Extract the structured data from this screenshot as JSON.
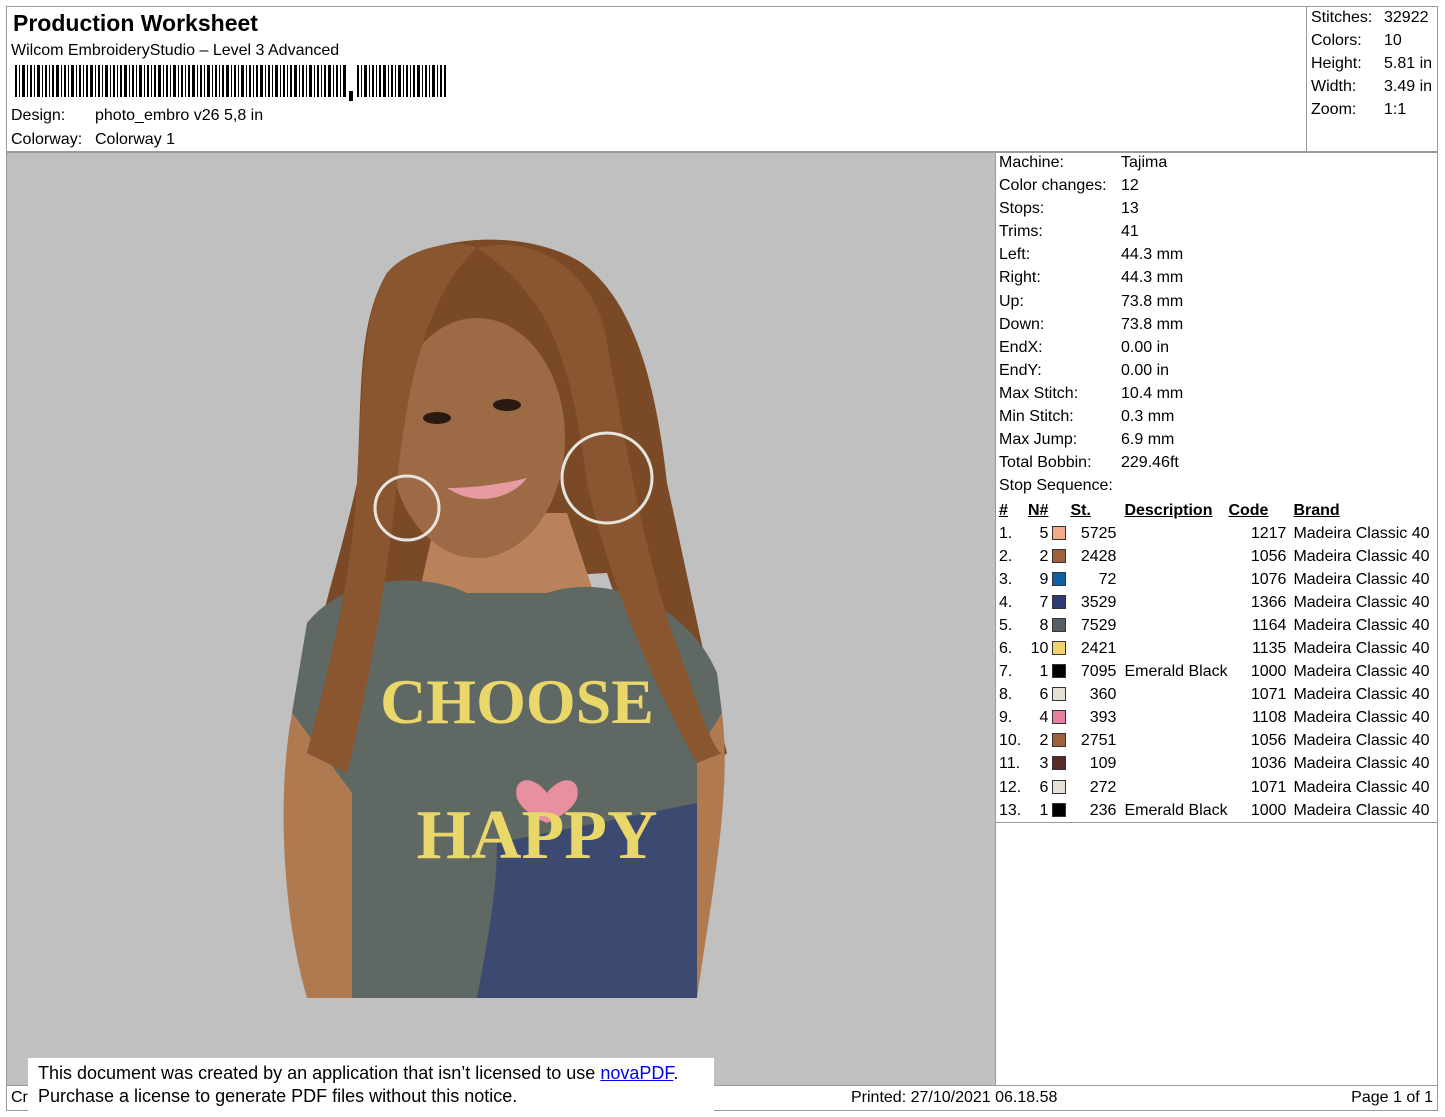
{
  "header": {
    "title": "Production Worksheet",
    "subtitle": "Wilcom EmbroideryStudio – Level 3 Advanced",
    "design_label": "Design:",
    "design_value": "photo_embro v26 5,8 in",
    "colorway_label": "Colorway:",
    "colorway_value": "Colorway 1"
  },
  "summary": [
    {
      "label": "Stitches:",
      "value": "32922"
    },
    {
      "label": "Colors:",
      "value": "10"
    },
    {
      "label": "Height:",
      "value": "5.81 in"
    },
    {
      "label": "Width:",
      "value": "3.49 in"
    },
    {
      "label": "Zoom:",
      "value": "1:1"
    }
  ],
  "machine_info": [
    {
      "label": "Machine:",
      "value": "Tajima"
    },
    {
      "label": "Color changes:",
      "value": "12"
    },
    {
      "label": "Stops:",
      "value": "13"
    },
    {
      "label": "Trims:",
      "value": "41"
    },
    {
      "label": "Left:",
      "value": "44.3 mm"
    },
    {
      "label": "Right:",
      "value": "44.3 mm"
    },
    {
      "label": "Up:",
      "value": "73.8 mm"
    },
    {
      "label": "Down:",
      "value": "73.8 mm"
    },
    {
      "label": "EndX:",
      "value": "0.00 in"
    },
    {
      "label": "EndY:",
      "value": "0.00 in"
    },
    {
      "label": "Max Stitch:",
      "value": "10.4 mm"
    },
    {
      "label": "Min Stitch:",
      "value": "0.3 mm"
    },
    {
      "label": "Max Jump:",
      "value": "6.9 mm"
    },
    {
      "label": "Total Bobbin:",
      "value": "229.46ft"
    }
  ],
  "stop_sequence": {
    "title": "Stop Sequence:",
    "columns": {
      "idx": "#",
      "n": "N#",
      "st": "St.",
      "desc": "Description",
      "code": "Code",
      "brand": "Brand"
    },
    "rows": [
      {
        "idx": "1.",
        "n": "5",
        "color": "#f2a98c",
        "st": "5725",
        "desc": "",
        "code": "1217",
        "brand": "Madeira Classic 40"
      },
      {
        "idx": "2.",
        "n": "2",
        "color": "#a0623a",
        "st": "2428",
        "desc": "",
        "code": "1056",
        "brand": "Madeira Classic 40"
      },
      {
        "idx": "3.",
        "n": "9",
        "color": "#0f5fa6",
        "st": "72",
        "desc": "",
        "code": "1076",
        "brand": "Madeira Classic 40"
      },
      {
        "idx": "4.",
        "n": "7",
        "color": "#2e3872",
        "st": "3529",
        "desc": "",
        "code": "1366",
        "brand": "Madeira Classic 40"
      },
      {
        "idx": "5.",
        "n": "8",
        "color": "#556066",
        "st": "7529",
        "desc": "",
        "code": "1164",
        "brand": "Madeira Classic 40"
      },
      {
        "idx": "6.",
        "n": "10",
        "color": "#f1d36a",
        "st": "2421",
        "desc": "",
        "code": "1135",
        "brand": "Madeira Classic 40"
      },
      {
        "idx": "7.",
        "n": "1",
        "color": "#000000",
        "st": "7095",
        "desc": "Emerald Black",
        "code": "1000",
        "brand": "Madeira Classic 40"
      },
      {
        "idx": "8.",
        "n": "6",
        "color": "#e4e0d6",
        "st": "360",
        "desc": "",
        "code": "1071",
        "brand": "Madeira Classic 40"
      },
      {
        "idx": "9.",
        "n": "4",
        "color": "#e87f9a",
        "st": "393",
        "desc": "",
        "code": "1108",
        "brand": "Madeira Classic 40"
      },
      {
        "idx": "10.",
        "n": "2",
        "color": "#a0623a",
        "st": "2751",
        "desc": "",
        "code": "1056",
        "brand": "Madeira Classic 40"
      },
      {
        "idx": "11.",
        "n": "3",
        "color": "#5a2a28",
        "st": "109",
        "desc": "",
        "code": "1036",
        "brand": "Madeira Classic 40"
      },
      {
        "idx": "12.",
        "n": "6",
        "color": "#e4e0d6",
        "st": "272",
        "desc": "",
        "code": "1071",
        "brand": "Madeira Classic 40"
      },
      {
        "idx": "13.",
        "n": "1",
        "color": "#000000",
        "st": "236",
        "desc": "Emerald Black",
        "code": "1000",
        "brand": "Madeira Classic 40"
      }
    ]
  },
  "preview": {
    "shirt_text_top": "CHOOSE",
    "shirt_text_bottom": "HAPPY"
  },
  "footer": {
    "left_text": "Cr",
    "printed": "Printed: 27/10/2021 06.18.58",
    "page": "Page 1 of 1"
  },
  "notice": {
    "line1_prefix": "This document was created by an application that isn’t licensed to use ",
    "link_text": "novaPDF",
    "line1_suffix": ".",
    "line2": "Purchase a license to generate PDF files without this notice."
  },
  "colors": {
    "background_preview": "#c0c0c0",
    "border": "#9a9a9a",
    "link": "#0000ee"
  }
}
